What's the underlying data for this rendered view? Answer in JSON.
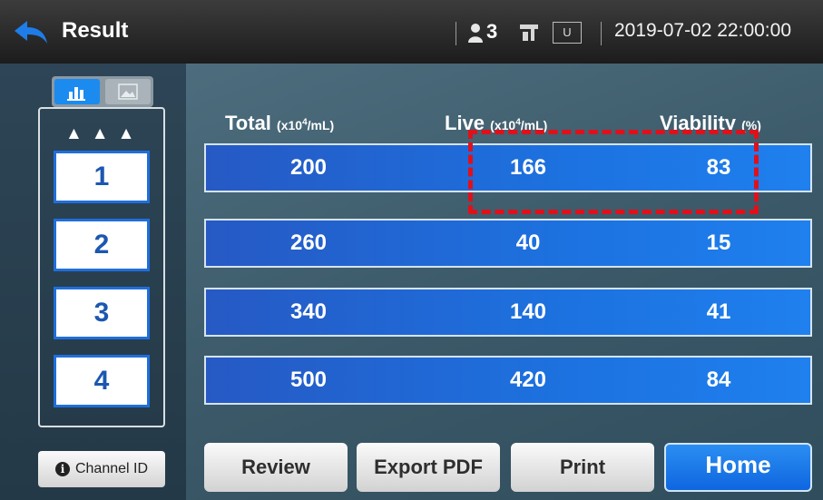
{
  "header": {
    "title": "Result",
    "user_count": "3",
    "usb_label": "U",
    "datetime": "2019-07-02 22:00:00"
  },
  "sidebar": {
    "triangles": "▲▲▲",
    "channels": [
      "1",
      "2",
      "3",
      "4"
    ],
    "channel_id_label": "Channel ID",
    "info_glyph": "i"
  },
  "table": {
    "headers": [
      {
        "name": "Total",
        "unit_open": "(x10",
        "exp": "4",
        "unit_close": "/mL)"
      },
      {
        "name": "Live",
        "unit_open": "(x10",
        "exp": "4",
        "unit_close": "/mL)"
      },
      {
        "name": "Viability",
        "unit_open": "(%)",
        "exp": "",
        "unit_close": ""
      }
    ],
    "rows": [
      [
        "200",
        "166",
        "83"
      ],
      [
        "260",
        "40",
        "15"
      ],
      [
        "340",
        "140",
        "41"
      ],
      [
        "500",
        "420",
        "84"
      ]
    ]
  },
  "actions": {
    "review": "Review",
    "export_pdf": "Export PDF",
    "print": "Print",
    "home": "Home"
  },
  "colors": {
    "accent": "#1c72e0",
    "highlight": "#e0101b"
  },
  "icons": [
    "back-arrow-icon",
    "user-icon",
    "device-icon",
    "bar-chart-icon",
    "image-icon",
    "info-icon"
  ]
}
